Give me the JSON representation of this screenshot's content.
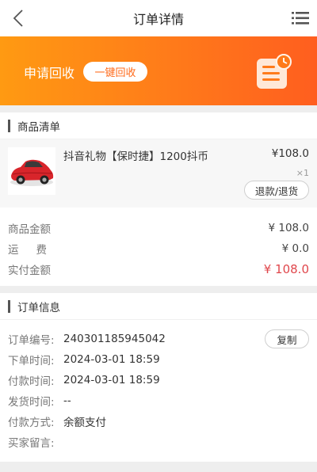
{
  "header": {
    "title": "订单详情",
    "back_icon": "chevron-left-icon",
    "menu_icon": "list-icon"
  },
  "banner": {
    "text": "申请回收",
    "button_label": "一键回收",
    "icon": "order-clock-icon",
    "colors": {
      "start": "#ff9a12",
      "end": "#ff5e1f"
    }
  },
  "goods": {
    "section_title": "商品清单",
    "item": {
      "name": "抖音礼物【保时捷】1200抖币",
      "price": "¥108.0",
      "quantity": "×1",
      "refund_label": "退款/退货",
      "thumbnail": "red-sports-car-image"
    },
    "amounts": [
      {
        "label": "商品金额",
        "value": "¥ 108.0"
      },
      {
        "label": "运费",
        "value": "¥ 0.0"
      },
      {
        "label": "实付金额",
        "value": "¥ 108.0"
      }
    ]
  },
  "order_info": {
    "section_title": "订单信息",
    "copy_label": "复制",
    "rows": [
      {
        "label": "订单编号:",
        "value": "240301185945042"
      },
      {
        "label": "下单时间:",
        "value": "2024-03-01 18:59"
      },
      {
        "label": "付款时间:",
        "value": "2024-03-01 18:59"
      },
      {
        "label": "发货时间:",
        "value": "--"
      },
      {
        "label": "付款方式:",
        "value": "余额支付"
      },
      {
        "label": "买家留言:",
        "value": ""
      }
    ]
  },
  "accent_red": "#e0474c"
}
